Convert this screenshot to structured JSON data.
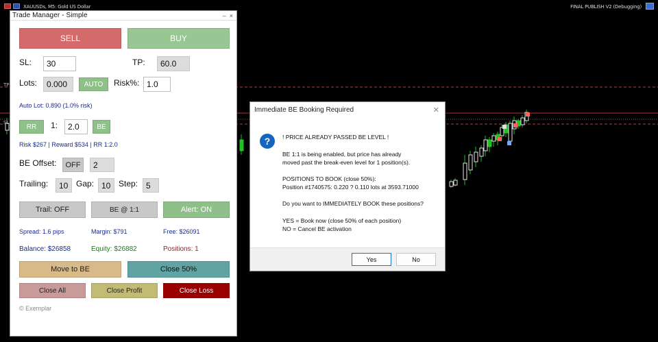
{
  "chart": {
    "symbol_label": "XAUUSDs, M5:  Gold US Dollar",
    "ea_label": "FINAL PUBLISH V2 (Debugging)",
    "left_tag_tp": "TP",
    "left_tag_sl": "SL",
    "colors": {
      "bull": "#22c022",
      "level_red": "#c03030",
      "level_dash": "#b04040",
      "level_grey": "#6b6b6b"
    }
  },
  "panel": {
    "title": "Trade Manager - Simple",
    "win_min": "–",
    "win_close": "×",
    "sell_label": "SELL",
    "buy_label": "BUY",
    "sl_label": "SL:",
    "sl_value": "30",
    "tp_label": "TP:",
    "tp_value": "60.0",
    "lots_label": "Lots:",
    "lots_value": "0.000",
    "auto_label": "AUTO",
    "risk_label": "Risk%:",
    "risk_value": "1.0",
    "auto_lot_info": "Auto Lot: 0.890 (1.0% risk)",
    "rr_label": "RR",
    "rr_ratio_prefix": "1:",
    "rr_value": "2.0",
    "be_label": "BE",
    "rr_info": "Risk $267 | Reward $534 | RR 1:2.0",
    "be_offset_label": "BE Offset:",
    "be_offset_toggle": "OFF",
    "be_offset_value": "2",
    "trailing_label": "Trailing:",
    "trailing_value": "10",
    "gap_label": "Gap:",
    "gap_value": "10",
    "step_label": "Step:",
    "step_value": "5",
    "trail_button": "Trail: OFF",
    "be_ratio_button": "BE @ 1:1",
    "alert_button": "Alert: ON",
    "spread": "Spread: 1.6 pips",
    "margin": "Margin: $791",
    "free": "Free: $26091",
    "balance": "Balance: $26858",
    "equity": "Equity: $26882",
    "positions": "Positions: 1",
    "move_to_be": "Move to BE",
    "close_50": "Close 50%",
    "close_all": "Close All",
    "close_profit": "Close Profit",
    "close_loss": "Close Loss",
    "footer": "© Exemplar",
    "colors": {
      "sell": "#d46a6a",
      "buy": "#98c793",
      "green_btn": "#8fc08a",
      "grey_btn": "#c8c8c8",
      "move_be": "#d8b98a",
      "close50": "#5fa3a3",
      "close_all": "#c99a9a",
      "close_profit": "#c2bb74",
      "close_loss": "#9b0000"
    }
  },
  "dialog": {
    "title": "Immediate BE Booking Required",
    "close_glyph": "✕",
    "icon": "?",
    "lines": [
      "! PRICE ALREADY PASSED BE LEVEL !",
      "BE 1:1 is being enabled, but price has already",
      "moved past the break-even level for 1 position(s).",
      "POSITIONS TO BOOK (close 50%):",
      "Position #1740575: 0.220 ? 0.110 lots at 3593.71000",
      "Do you want to IMMEDIATELY BOOK these positions?",
      "YES = Book now (close 50% of each position)",
      "NO = Cancel BE activation"
    ],
    "yes_label": "Yes",
    "no_label": "No"
  }
}
